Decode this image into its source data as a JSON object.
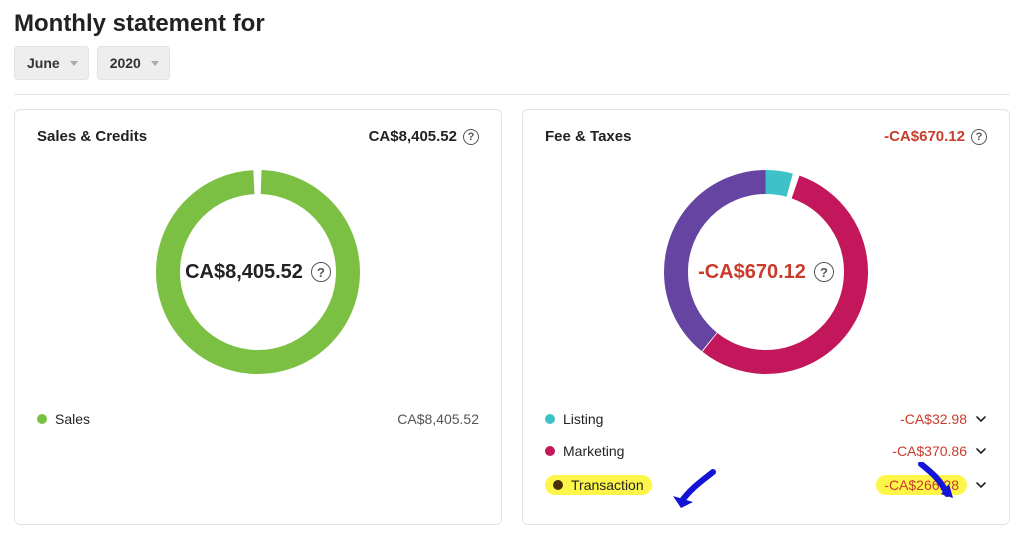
{
  "title": "Monthly statement for",
  "month": "June",
  "year": "2020",
  "sales_panel": {
    "title": "Sales & Credits",
    "total": "CA$8,405.52",
    "center": "CA$8,405.52",
    "colors": {
      "sales": "#7bc043"
    },
    "legend": [
      {
        "label": "Sales",
        "value": "CA$8,405.52",
        "color": "#7bc043"
      }
    ]
  },
  "fees_panel": {
    "title": "Fee & Taxes",
    "total": "-CA$670.12",
    "center": "-CA$670.12",
    "colors": {
      "listing": "#3fc1c9",
      "marketing": "#c2185b",
      "transaction": "#6644a1"
    },
    "legend": [
      {
        "label": "Listing",
        "value": "-CA$32.98",
        "color": "#3fc1c9",
        "expandable": true,
        "highlight": false
      },
      {
        "label": "Marketing",
        "value": "-CA$370.86",
        "color": "#c2185b",
        "expandable": true,
        "highlight": false
      },
      {
        "label": "Transaction",
        "value": "-CA$266.28",
        "color": "#6644a1",
        "expandable": true,
        "highlight": true
      }
    ]
  },
  "chart_data": [
    {
      "type": "pie",
      "title": "Sales & Credits",
      "total_label": "CA$8,405.52",
      "series": [
        {
          "name": "Sales",
          "value": 8405.52,
          "color": "#7bc043"
        }
      ]
    },
    {
      "type": "pie",
      "title": "Fee & Taxes",
      "total_label": "-CA$670.12",
      "series": [
        {
          "name": "Listing",
          "value": 32.98,
          "color": "#3fc1c9"
        },
        {
          "name": "Marketing",
          "value": 370.86,
          "color": "#c2185b"
        },
        {
          "name": "Transaction",
          "value": 266.28,
          "color": "#6644a1"
        }
      ]
    }
  ]
}
